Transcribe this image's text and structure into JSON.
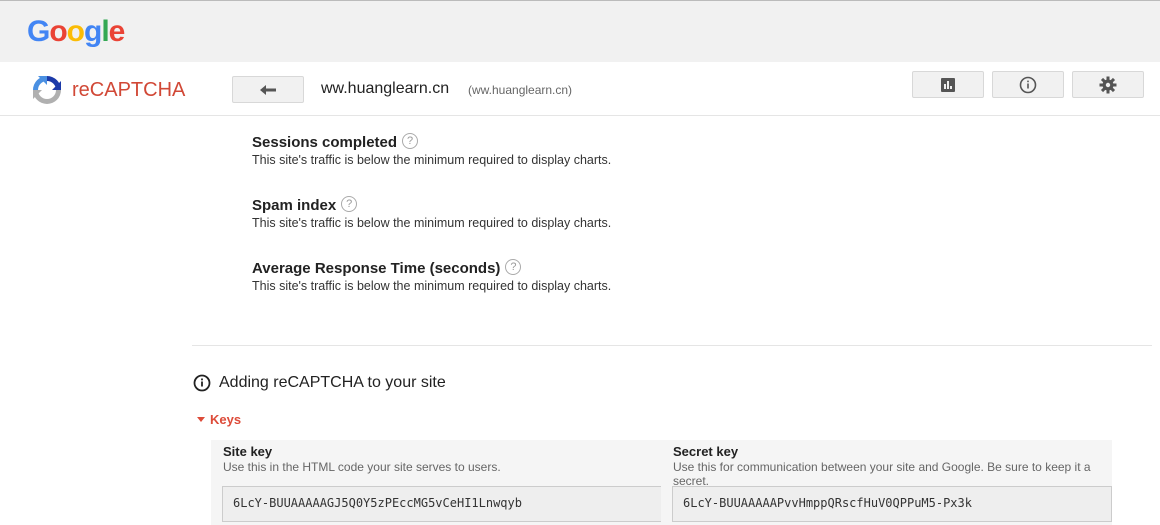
{
  "google": {
    "logo_letters": [
      {
        "ch": "G",
        "color": "#4285F4"
      },
      {
        "ch": "o",
        "color": "#EA4335"
      },
      {
        "ch": "o",
        "color": "#FBBC05"
      },
      {
        "ch": "g",
        "color": "#4285F4"
      },
      {
        "ch": "l",
        "color": "#34A853"
      },
      {
        "ch": "e",
        "color": "#EA4335"
      }
    ]
  },
  "header": {
    "logo_icon": "recaptcha-logo-icon",
    "title": "reCAPTCHA",
    "back_icon": "arrow-left-icon",
    "site_label": "ww.huanglearn.cn",
    "site_domain": "(ww.huanglearn.cn)",
    "toolbar_icons": [
      "analytics-icon",
      "info-icon",
      "gear-icon"
    ]
  },
  "stats": [
    {
      "title": "Sessions completed",
      "desc": "This site's traffic is below the minimum required to display charts."
    },
    {
      "title": "Spam index",
      "desc": "This site's traffic is below the minimum required to display charts."
    },
    {
      "title": "Average Response Time (seconds)",
      "desc": "This site's traffic is below the minimum required to display charts."
    }
  ],
  "help_glyph": "?",
  "adding": {
    "title": "Adding reCAPTCHA to your site",
    "keys_label": "Keys"
  },
  "keys": {
    "site": {
      "label": "Site key",
      "help": "Use this in the HTML code your site serves to users.",
      "value": "6LcY-BUUAAAAAGJ5Q0Y5zPEccMG5vCeHI1Lnwqyb"
    },
    "secret": {
      "label": "Secret key",
      "help": "Use this for communication between your site and Google. Be sure to keep it a secret.",
      "value": "6LcY-BUUAAAAAPvvHmppQRscfHuV0QPPuM5-Px3k"
    }
  },
  "colors": {
    "accent": "#dd4b39",
    "brand_red": "#d14836"
  }
}
